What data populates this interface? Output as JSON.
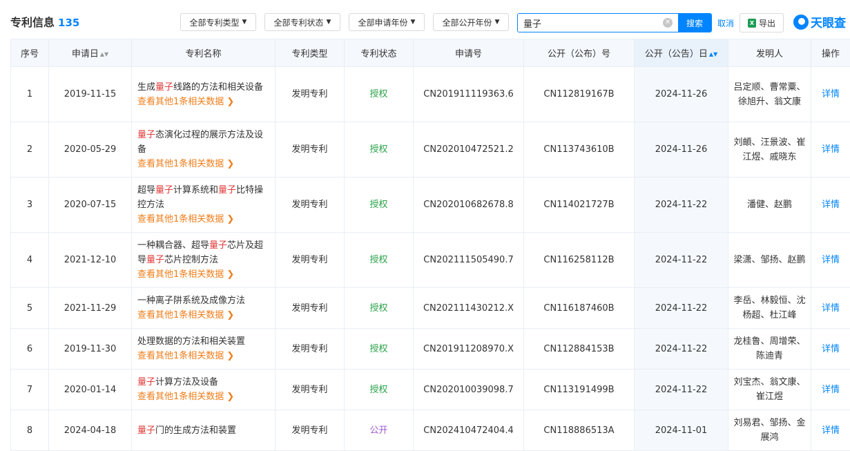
{
  "header": {
    "title": "专利信息",
    "count": "135",
    "filters": [
      "全部专利类型",
      "全部专利状态",
      "全部申请年份",
      "全部公开年份"
    ],
    "search_value": "量子",
    "search_label": "搜索",
    "cancel_label": "取消",
    "export_label": "导出",
    "brand": "天眼查"
  },
  "columns": [
    "序号",
    "申请日",
    "专利名称",
    "专利类型",
    "专利状态",
    "申请号",
    "公开（公布）号",
    "公开（公告）日",
    "发明人",
    "操作"
  ],
  "rows": [
    {
      "no": "1",
      "date": "2019-11-15",
      "name": [
        {
          "t": "生成"
        },
        {
          "t": "量子",
          "h": true
        },
        {
          "t": "线路的方法和相关设备"
        }
      ],
      "more": "查看其他1条相关数据 ❯",
      "type": "发明专利",
      "status": "授权",
      "status_kind": "granted",
      "app_no": "CN201911119363.6",
      "pub_no": "CN112819167B",
      "pub_date": "2024-11-26",
      "inventors": "吕定顺、曹常粟、徐旭升、翁文康",
      "action": "详情",
      "h": "h80"
    },
    {
      "no": "2",
      "date": "2020-05-29",
      "name": [
        {
          "t": "量子",
          "h": true
        },
        {
          "t": "态演化过程的展示方法及设备"
        }
      ],
      "more": "查看其他1条相关数据 ❯",
      "type": "发明专利",
      "status": "授权",
      "status_kind": "granted",
      "app_no": "CN202010472521.2",
      "pub_no": "CN113743610B",
      "pub_date": "2024-11-26",
      "inventors": "刘頔、汪景波、崔江煜、戚晓东",
      "action": "详情",
      "h": "h80"
    },
    {
      "no": "3",
      "date": "2020-07-15",
      "name": [
        {
          "t": "超导"
        },
        {
          "t": "量子",
          "h": true
        },
        {
          "t": "计算系统和"
        },
        {
          "t": "量子",
          "h": true
        },
        {
          "t": "比特操控方法"
        }
      ],
      "more": "查看其他1条相关数据 ❯",
      "type": "发明专利",
      "status": "授权",
      "status_kind": "granted",
      "app_no": "CN202010682678.8",
      "pub_no": "CN114021727B",
      "pub_date": "2024-11-22",
      "inventors": "潘健、赵鹏",
      "action": "详情",
      "h": "h80"
    },
    {
      "no": "4",
      "date": "2021-12-10",
      "name": [
        {
          "t": "一种耦合器、超导"
        },
        {
          "t": "量子",
          "h": true
        },
        {
          "t": "芯片及超导"
        },
        {
          "t": "量子",
          "h": true
        },
        {
          "t": "芯片控制方法"
        }
      ],
      "more": "查看其他1条相关数据 ❯",
      "type": "发明专利",
      "status": "授权",
      "status_kind": "granted",
      "app_no": "CN202111505490.7",
      "pub_no": "CN116258112B",
      "pub_date": "2024-11-22",
      "inventors": "梁潇、邹扬、赵鹏",
      "action": "详情",
      "h": "h80"
    },
    {
      "no": "5",
      "date": "2021-11-29",
      "name": [
        {
          "t": "一种离子阱系统及成像方法"
        }
      ],
      "more": "查看其他1条相关数据 ❯",
      "type": "发明专利",
      "status": "授权",
      "status_kind": "granted",
      "app_no": "CN202111430212.X",
      "pub_no": "CN116187460B",
      "pub_date": "2024-11-22",
      "inventors": "李岳、林毅恒、沈杨超、杜江峰",
      "action": "详情",
      "h": "h59"
    },
    {
      "no": "6",
      "date": "2019-11-30",
      "name": [
        {
          "t": "处理数据的方法和相关装置"
        }
      ],
      "more": "查看其他1条相关数据 ❯",
      "type": "发明专利",
      "status": "授权",
      "status_kind": "granted",
      "app_no": "CN201911208970.X",
      "pub_no": "CN112884153B",
      "pub_date": "2024-11-22",
      "inventors": "龙桂鲁、周增荣、陈迪青",
      "action": "详情",
      "h": "h59"
    },
    {
      "no": "7",
      "date": "2020-01-14",
      "name": [
        {
          "t": "量子",
          "h": true
        },
        {
          "t": "计算方法及设备"
        }
      ],
      "more": "查看其他1条相关数据 ❯",
      "type": "发明专利",
      "status": "授权",
      "status_kind": "granted",
      "app_no": "CN202010039098.7",
      "pub_no": "CN113191499B",
      "pub_date": "2024-11-22",
      "inventors": "刘宝杰、翁文康、崔江煜",
      "action": "详情",
      "h": "h59"
    },
    {
      "no": "8",
      "date": "2024-04-18",
      "name": [
        {
          "t": "量子",
          "h": true
        },
        {
          "t": "门的生成方法和装置"
        }
      ],
      "more": "",
      "type": "发明专利",
      "status": "公开",
      "status_kind": "public",
      "app_no": "CN202410472404.4",
      "pub_no": "CN118886513A",
      "pub_date": "2024-11-01",
      "inventors": "刘易君、邹扬、金展鸿",
      "action": "详情",
      "h": "h59"
    }
  ]
}
